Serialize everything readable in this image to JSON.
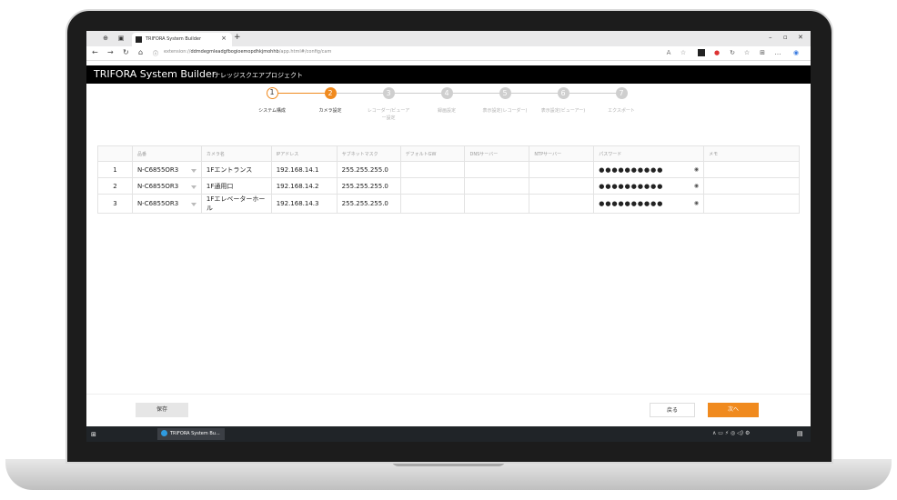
{
  "browser": {
    "tab_title": "TRIFORA System Builder",
    "tab_close": "×",
    "new_tab": "+",
    "url_prefix": "extension://",
    "url_host": "ddmdegmleadgfbogioemopdhkjmohhb",
    "url_path": "/app.html#/config/cam",
    "window_controls": [
      "–",
      "▫",
      "✕"
    ]
  },
  "app": {
    "brand": "TRIFORA System Builder",
    "project": "ナレッジスクエアプロジェクト"
  },
  "steps": [
    {
      "num": "1",
      "label": "システム構成",
      "state": "done"
    },
    {
      "num": "2",
      "label": "カメラ設定",
      "state": "active"
    },
    {
      "num": "3",
      "label": "レコーダー/ビューアー設定",
      "state": "pending"
    },
    {
      "num": "4",
      "label": "録画設定",
      "state": "pending"
    },
    {
      "num": "5",
      "label": "表示設定(レコーダー)",
      "state": "pending"
    },
    {
      "num": "6",
      "label": "表示設定(ビューアー)",
      "state": "pending"
    },
    {
      "num": "7",
      "label": "エクスポート",
      "state": "pending"
    }
  ],
  "table": {
    "headers": [
      "",
      "品番",
      "カメラ名",
      "IPアドレス",
      "サブネットマスク",
      "デフォルトGW",
      "DNSサーバー",
      "NTPサーバー",
      "パスワード",
      "メモ"
    ],
    "rows": [
      {
        "no": "1",
        "model": "N-C6855OR3",
        "name": "1Fエントランス",
        "ip": "192.168.14.1",
        "mask": "255.255.255.0",
        "gw": "",
        "dns": "",
        "ntp": "",
        "password": "●●●●●●●●●●",
        "memo": ""
      },
      {
        "no": "2",
        "model": "N-C6855OR3",
        "name": "1F通用口",
        "ip": "192.168.14.2",
        "mask": "255.255.255.0",
        "gw": "",
        "dns": "",
        "ntp": "",
        "password": "●●●●●●●●●●",
        "memo": ""
      },
      {
        "no": "3",
        "model": "N-C6855OR3",
        "name": "1Fエレベーターホール",
        "ip": "192.168.14.3",
        "mask": "255.255.255.0",
        "gw": "",
        "dns": "",
        "ntp": "",
        "password": "●●●●●●●●●●",
        "memo": ""
      }
    ]
  },
  "buttons": {
    "save": "保存",
    "back": "戻る",
    "next": "次へ"
  },
  "taskbar": {
    "task_label": "TRIFORA System Bu...",
    "tray": "∧ ▭ ⚡ ◎ ◁) ⚙"
  },
  "colors": {
    "accent": "#f08a1e",
    "header": "#000000"
  }
}
